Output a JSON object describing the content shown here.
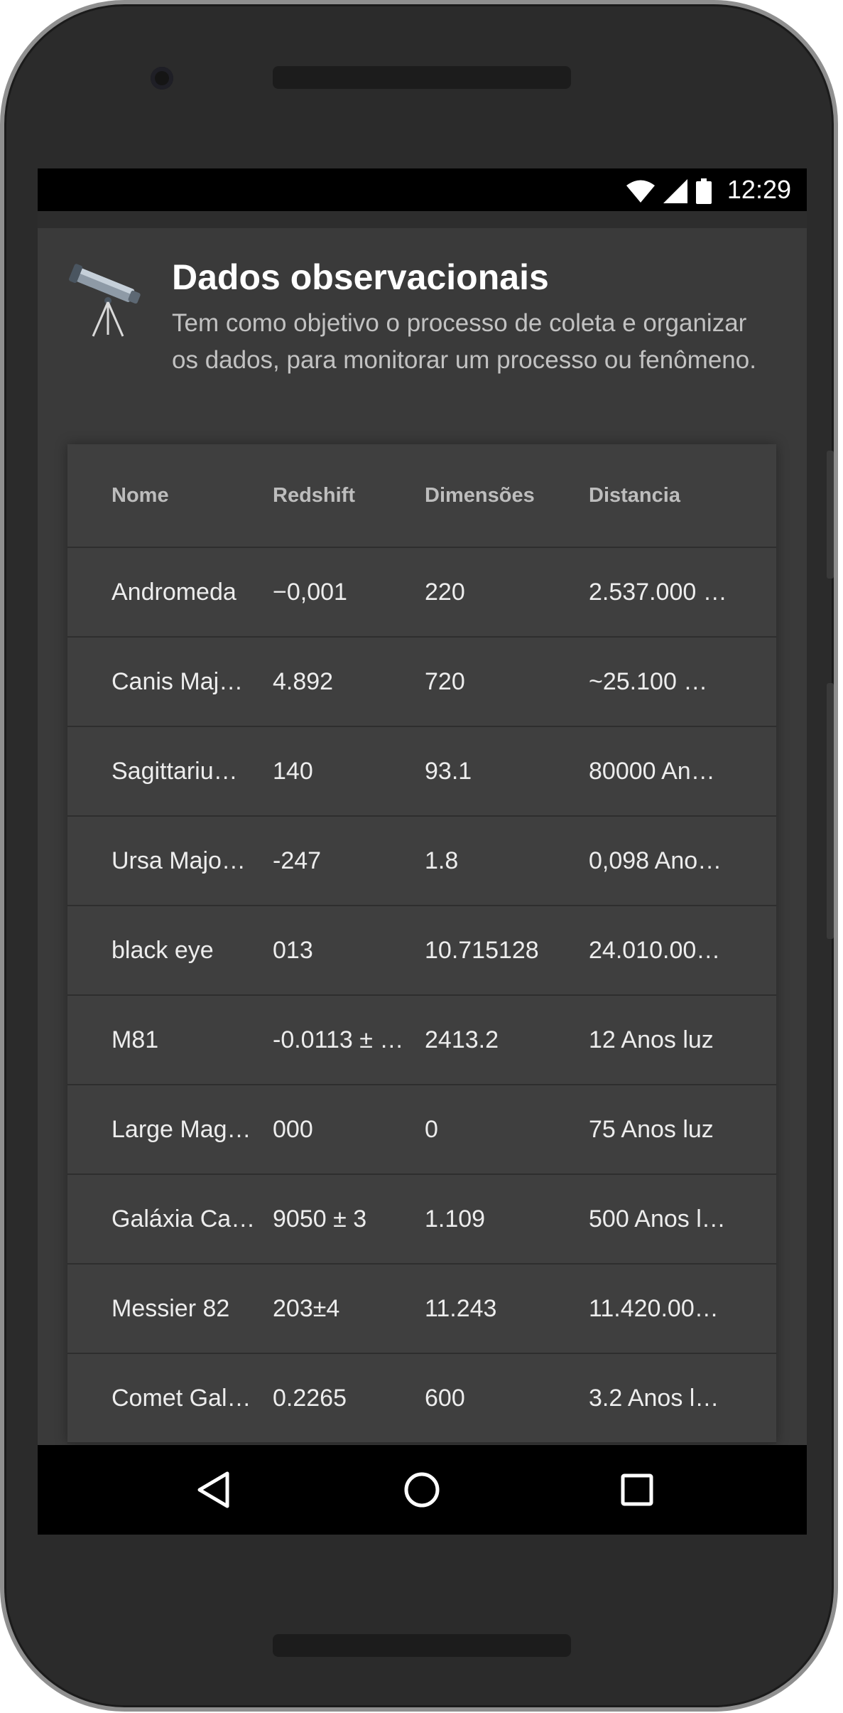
{
  "status_bar": {
    "time": "12:29",
    "icons": [
      "wifi-icon",
      "signal-icon",
      "battery-icon"
    ]
  },
  "header": {
    "icon": "telescope-icon",
    "title": "Dados observacionais",
    "subtitle": "Tem como objetivo o processo de coleta e organizar os dados, para monitorar um processo ou fenômeno."
  },
  "table": {
    "columns": [
      "Nome",
      "Redshift",
      "Dimensões",
      "Distancia"
    ],
    "rows": [
      [
        "Andromeda",
        "−0,001",
        "220",
        "2.537.000 …"
      ],
      [
        "Canis Maj…",
        "4.892",
        "720",
        "~25.100 …"
      ],
      [
        "Sagittariu…",
        "140",
        "93.1",
        "80000 An…"
      ],
      [
        "Ursa Majo…",
        "-247",
        "1.8",
        "0,098 Ano…"
      ],
      [
        "black eye",
        "013",
        "10.715128",
        "24.010.00…"
      ],
      [
        "M81",
        "-0.0113 ± …",
        "2413.2",
        "12 Anos luz"
      ],
      [
        "Large Mag…",
        "000",
        "0",
        "75 Anos luz"
      ],
      [
        "Galáxia Ca…",
        "9050 ± 3",
        "1.109",
        "500 Anos l…"
      ],
      [
        "Messier 82",
        "203±4",
        "11.243",
        "11.420.00…"
      ],
      [
        "Comet Gal…",
        "0.2265",
        "600",
        "3.2 Anos l…"
      ]
    ]
  },
  "nav_bar": {
    "buttons": [
      "back-icon",
      "home-icon",
      "recents-icon"
    ]
  },
  "colors": {
    "screen_background": "#2d2d2d",
    "card_background": "#3a3a3a",
    "table_background": "#3f3f3f",
    "title_text": "#ffffff",
    "subtitle_text": "#c2c2c2"
  }
}
